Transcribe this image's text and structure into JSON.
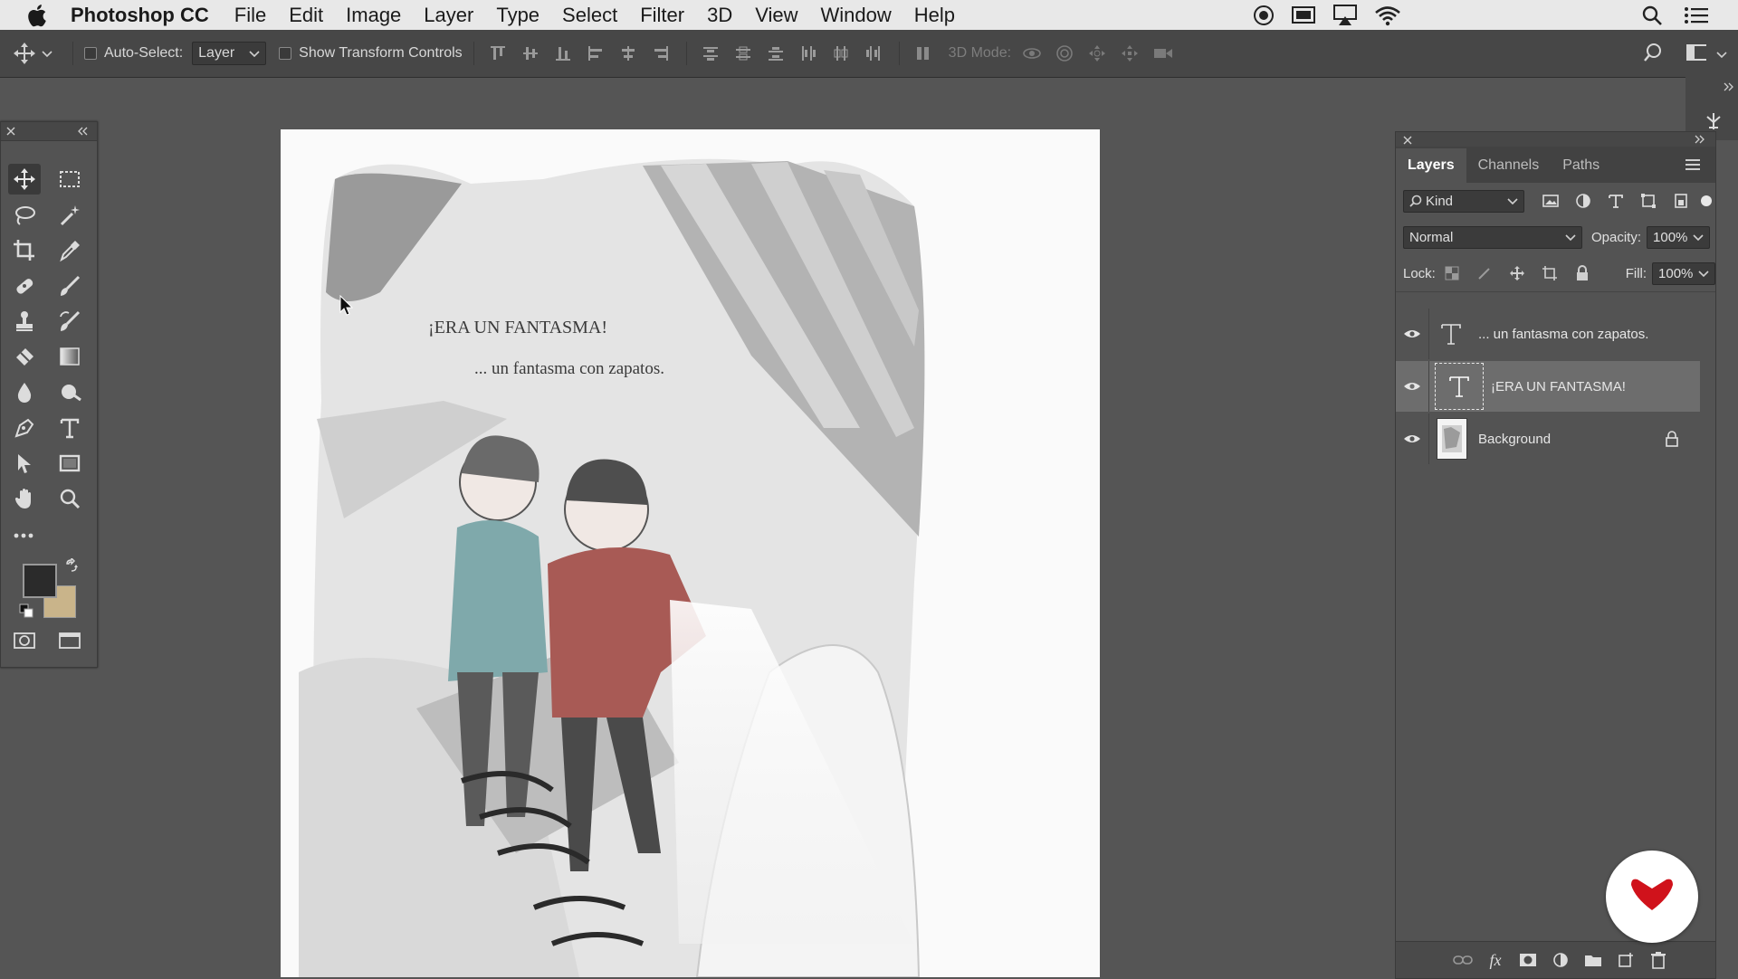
{
  "menubar": {
    "app_name": "Photoshop CC",
    "items": [
      "File",
      "Edit",
      "Image",
      "Layer",
      "Type",
      "Select",
      "Filter",
      "3D",
      "View",
      "Window",
      "Help"
    ],
    "status_icons": [
      "record-icon",
      "screen-mirror-icon",
      "airplay-icon",
      "wifi-icon",
      "spotlight-search-icon",
      "notification-list-icon"
    ]
  },
  "options_bar": {
    "auto_select_label": "Auto-Select:",
    "auto_select_value": "Layer",
    "show_transform_label": "Show Transform Controls",
    "mode_3d_label": "3D Mode:"
  },
  "tools": {
    "rows": [
      [
        "move-tool-icon",
        "marquee-tool-icon"
      ],
      [
        "lasso-tool-icon",
        "magic-wand-tool-icon"
      ],
      [
        "crop-tool-icon",
        "eyedropper-tool-icon"
      ],
      [
        "healing-brush-tool-icon",
        "brush-tool-icon"
      ],
      [
        "clone-stamp-tool-icon",
        "history-brush-tool-icon"
      ],
      [
        "eraser-tool-icon",
        "gradient-tool-icon"
      ],
      [
        "blur-tool-icon",
        "dodge-tool-icon"
      ],
      [
        "pen-tool-icon",
        "type-tool-icon"
      ],
      [
        "path-selection-tool-icon",
        "rectangle-tool-icon"
      ],
      [
        "hand-tool-icon",
        "zoom-tool-icon"
      ]
    ],
    "foreground_color": "#2b2b2b",
    "background_color": "#c9b48a"
  },
  "canvas": {
    "heading": "¡ERA UN FANTASMA!",
    "subheading": "... un fantasma con zapatos."
  },
  "layers_panel": {
    "tabs": [
      "Layers",
      "Channels",
      "Paths"
    ],
    "filter_kind": "Kind",
    "blend_mode": "Normal",
    "opacity_label": "Opacity:",
    "opacity_value": "100%",
    "lock_label": "Lock:",
    "fill_label": "Fill:",
    "fill_value": "100%",
    "layers": [
      {
        "name": "... un fantasma con zapatos.",
        "type": "text",
        "selected": false
      },
      {
        "name": "¡ERA UN FANTASMA!",
        "type": "text",
        "selected": true
      },
      {
        "name": "Background",
        "type": "image",
        "selected": false,
        "locked": true
      }
    ]
  },
  "colors": {
    "accent_logo": "#d0121b"
  }
}
